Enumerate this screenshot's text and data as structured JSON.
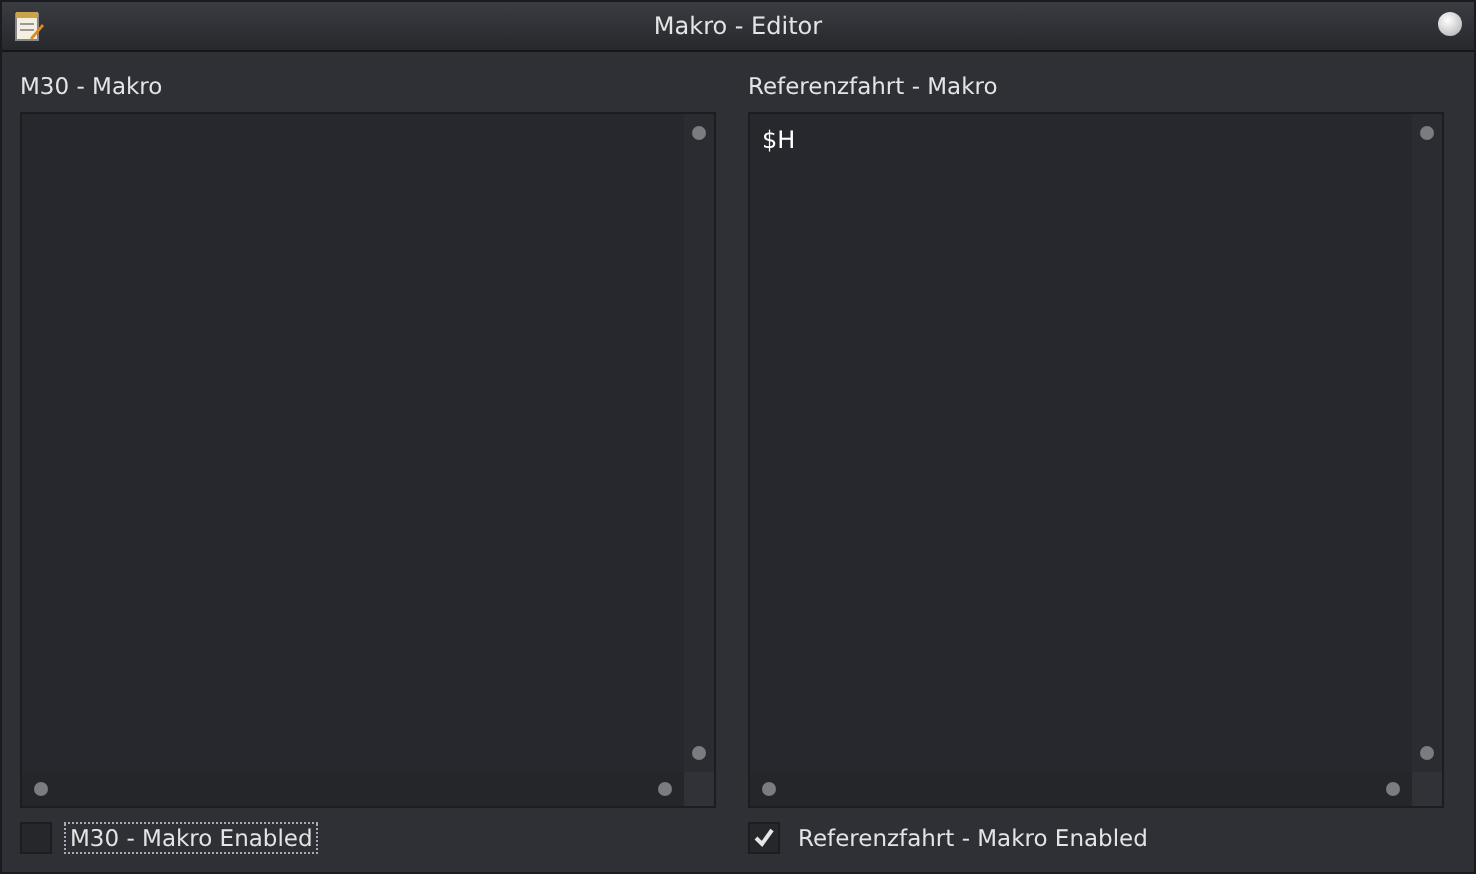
{
  "window": {
    "title": "Makro - Editor"
  },
  "panels": [
    {
      "label": "M30 - Makro",
      "enabled": {
        "label": "M30 - Makro Enabled",
        "checked": false,
        "focused": true
      }
    },
    {
      "label": "Referenzfahrt - Makro",
      "content": "$H",
      "enabled": {
        "label": "Referenzfahrt - Makro Enabled",
        "checked": true,
        "focused": false
      }
    }
  ]
}
